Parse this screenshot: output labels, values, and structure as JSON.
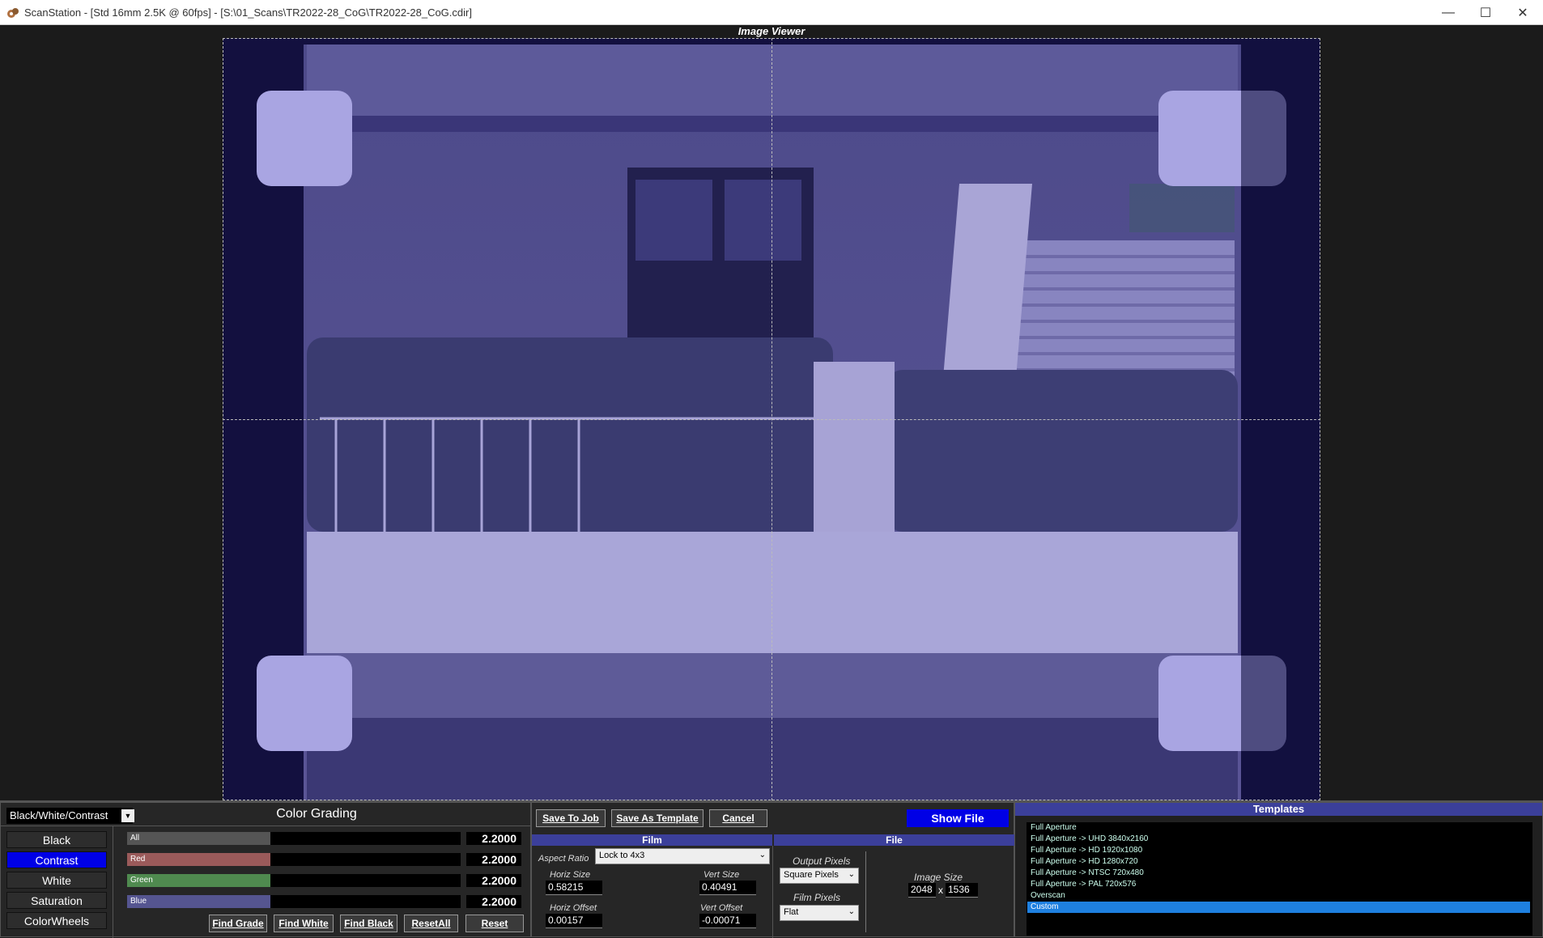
{
  "window": {
    "title": "ScanStation - [Std 16mm 2.5K @ 60fps] - [S:\\01_Scans\\TR2022-28_CoG\\TR2022-28_CoG.cdir]",
    "minimize": "—",
    "maximize": "☐",
    "close": "✕"
  },
  "viewer": {
    "label": "Image Viewer"
  },
  "grading": {
    "mode_select": "Black/White/Contrast",
    "title": "Color Grading",
    "tabs": [
      "Black",
      "Contrast",
      "White",
      "Saturation",
      "ColorWheels"
    ],
    "active_tab": "Contrast",
    "sliders": [
      {
        "label": "All",
        "value": "2.2000",
        "fill": 0.43,
        "color": "#555555"
      },
      {
        "label": "Red",
        "value": "2.2000",
        "fill": 0.43,
        "color": "#9a5a5a"
      },
      {
        "label": "Green",
        "value": "2.2000",
        "fill": 0.43,
        "color": "#4f8a4f"
      },
      {
        "label": "Blue",
        "value": "2.2000",
        "fill": 0.43,
        "color": "#555590"
      }
    ],
    "buttons": {
      "find_grade": "Find Grade",
      "find_white": "Find White",
      "find_black": "Find Black",
      "reset_all": "ResetAll",
      "reset": "Reset"
    }
  },
  "toolbar": {
    "save_to_job": "Save To Job",
    "save_as_template": "Save As Template",
    "cancel": "Cancel",
    "show_file": "Show File"
  },
  "film": {
    "header": "Film",
    "aspect_ratio_label": "Aspect Ratio",
    "aspect_ratio_value": "Lock to 4x3",
    "horiz_size_label": "Horiz Size",
    "horiz_size": "0.58215",
    "vert_size_label": "Vert Size",
    "vert_size": "0.40491",
    "horiz_offset_label": "Horiz Offset",
    "horiz_offset": "0.00157",
    "vert_offset_label": "Vert Offset",
    "vert_offset": "-0.00071",
    "output_pixels_label": "Output Pixels",
    "output_pixels": "Square Pixels",
    "film_pixels_label": "Film Pixels",
    "film_pixels": "Flat"
  },
  "file": {
    "header": "File",
    "image_size_label": "Image Size",
    "width": "2048",
    "x": "x",
    "height": "1536"
  },
  "templates": {
    "header": "Templates",
    "items": [
      "Full Aperture",
      "Full Aperture -> UHD 3840x2160",
      "Full Aperture -> HD 1920x1080",
      "Full Aperture -> HD 1280x720",
      "Full Aperture -> NTSC 720x480",
      "Full Aperture -> PAL 720x576",
      "Overscan",
      "Custom"
    ],
    "selected": "Custom"
  }
}
